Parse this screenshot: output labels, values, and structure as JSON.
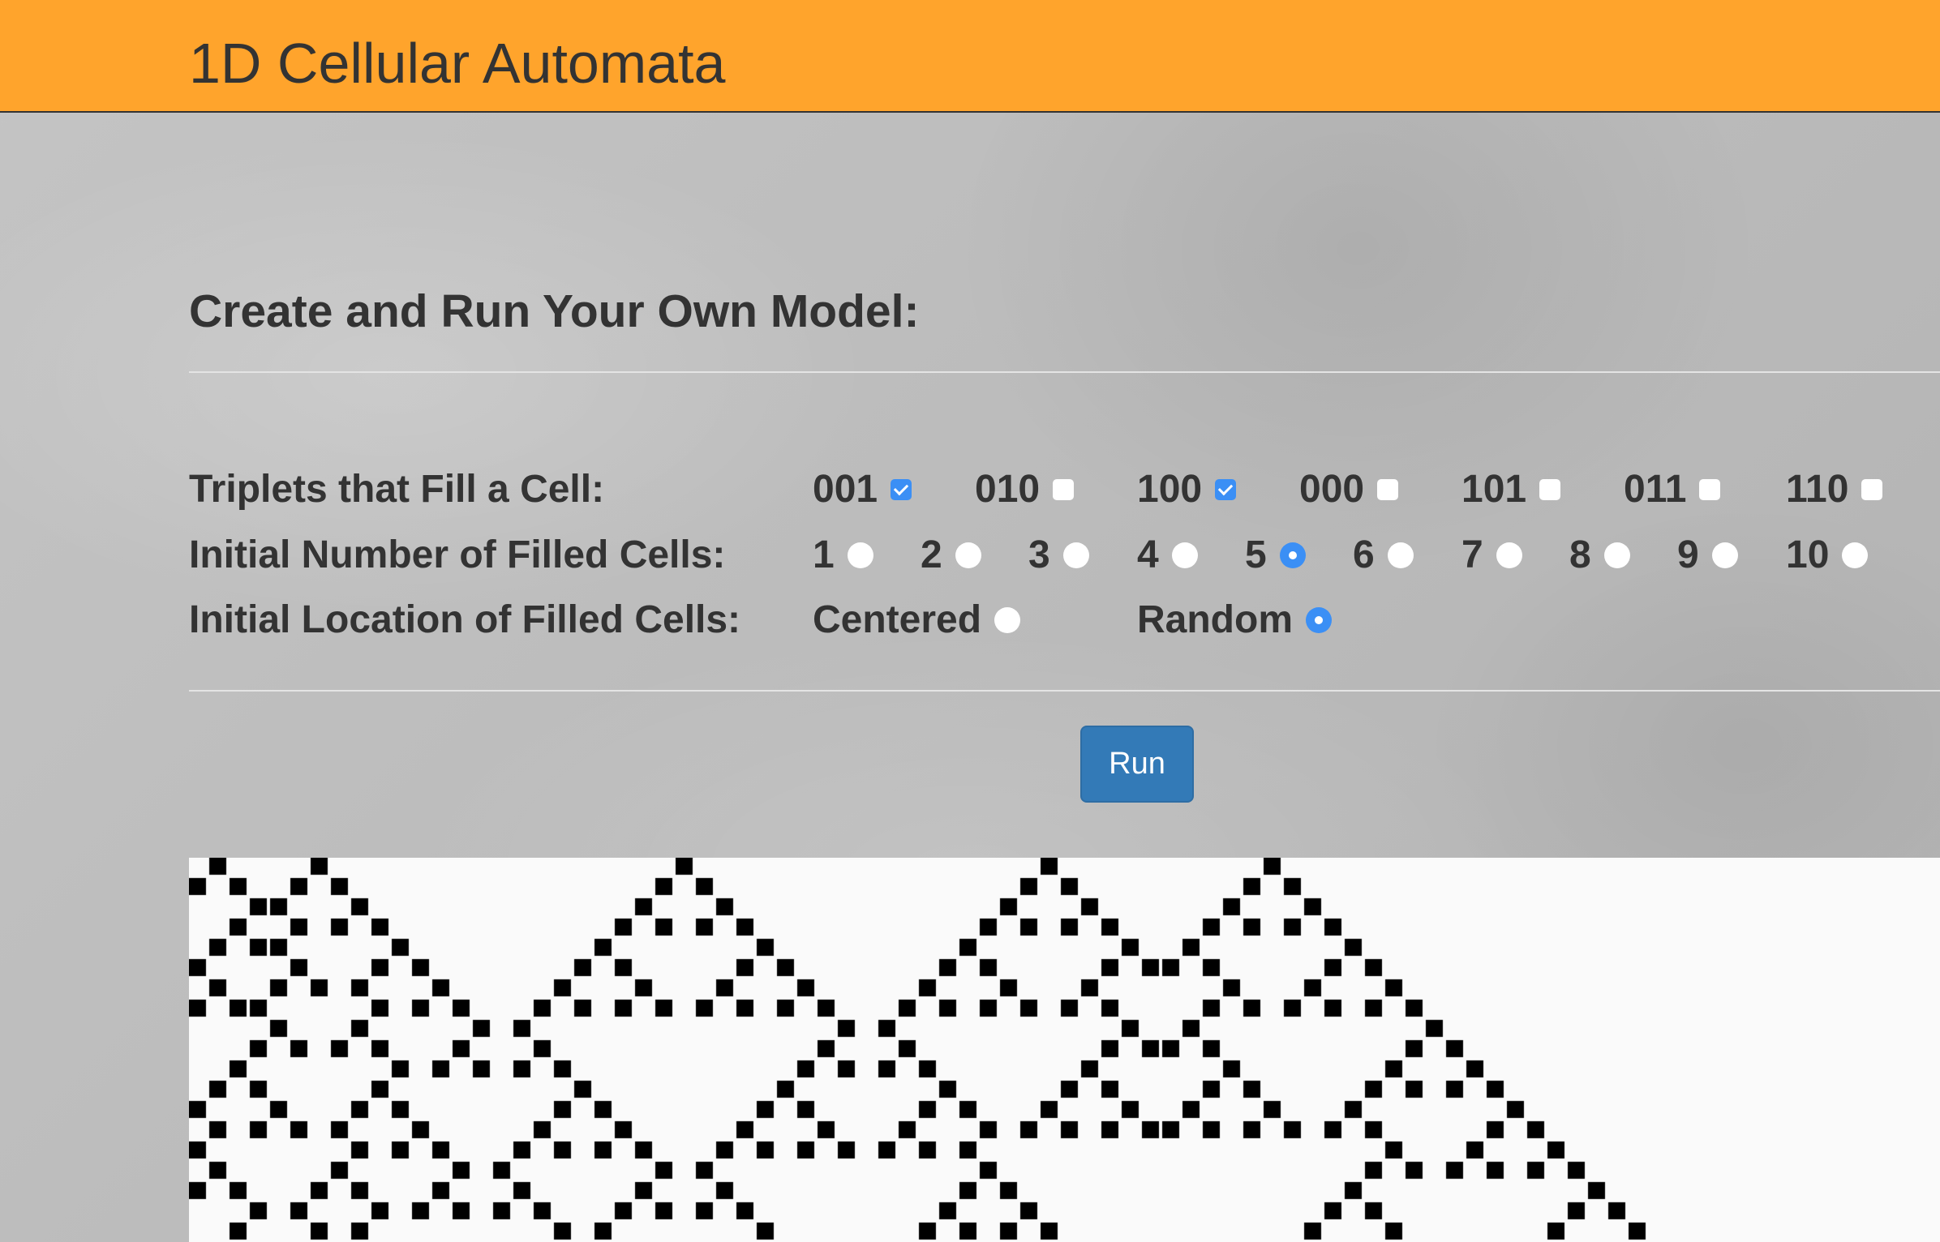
{
  "navbar": {
    "title": "1D Cellular Automata"
  },
  "panel": {
    "title": "Create and Run Your Own Model:",
    "triplets": {
      "label": "Triplets that Fill a Cell:",
      "options": [
        {
          "label": "001",
          "checked": true
        },
        {
          "label": "010",
          "checked": false
        },
        {
          "label": "100",
          "checked": true
        },
        {
          "label": "000",
          "checked": false
        },
        {
          "label": "101",
          "checked": false
        },
        {
          "label": "011",
          "checked": false
        },
        {
          "label": "110",
          "checked": false
        }
      ]
    },
    "initial_count": {
      "label": "Initial Number of Filled Cells:",
      "options": [
        "1",
        "2",
        "3",
        "4",
        "5",
        "6",
        "7",
        "8",
        "9",
        "10"
      ],
      "selected": "5"
    },
    "initial_location": {
      "label": "Initial Location of Filled Cells:",
      "options": [
        "Centered",
        "Random"
      ],
      "selected": "Random"
    },
    "run_label": "Run"
  },
  "canvas": {
    "cell_color": "#000000",
    "background_color": "#fafafa",
    "rule_triplets": [
      "001",
      "100"
    ]
  }
}
